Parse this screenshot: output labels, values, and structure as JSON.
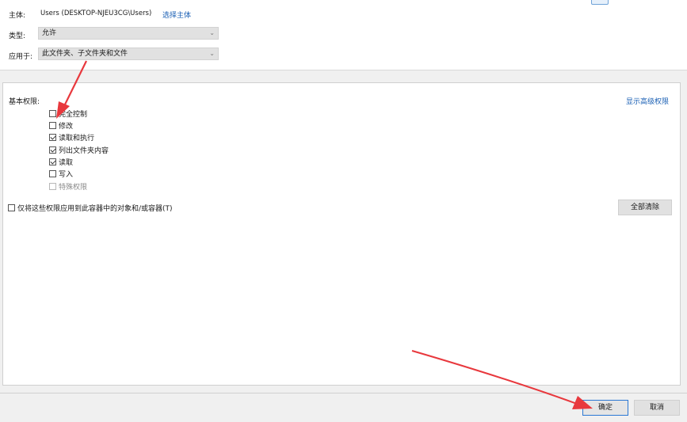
{
  "top": {
    "principal_label": "主体:",
    "principal_value": "Users (DESKTOP-NJEU3CG\\Users)",
    "select_principal_link": "选择主体",
    "type_label": "类型:",
    "type_value": "允许",
    "applies_label": "应用于:",
    "applies_value": "此文件夹、子文件夹和文件"
  },
  "main": {
    "basic_permissions_label": "基本权限:",
    "show_advanced_link": "显示高级权限",
    "permissions": [
      {
        "label": "完全控制",
        "checked": false,
        "enabled": true
      },
      {
        "label": "修改",
        "checked": false,
        "enabled": true
      },
      {
        "label": "读取和执行",
        "checked": true,
        "enabled": true
      },
      {
        "label": "列出文件夹内容",
        "checked": true,
        "enabled": true
      },
      {
        "label": "读取",
        "checked": true,
        "enabled": true
      },
      {
        "label": "写入",
        "checked": false,
        "enabled": true
      },
      {
        "label": "特殊权限",
        "checked": false,
        "enabled": false
      }
    ],
    "apply_only_label": "仅将这些权限应用到此容器中的对象和/或容器(T)",
    "apply_only_checked": false,
    "clear_all_button": "全部清除"
  },
  "footer": {
    "ok_button": "确定",
    "cancel_button": "取消"
  },
  "colors": {
    "link": "#1a5fb4",
    "annotation_arrow": "#e8383d",
    "default_button_border": "#2b78d4"
  },
  "icons": {
    "dropdown": "chevron-down-icon",
    "annotation": "red-arrow-annotation"
  }
}
